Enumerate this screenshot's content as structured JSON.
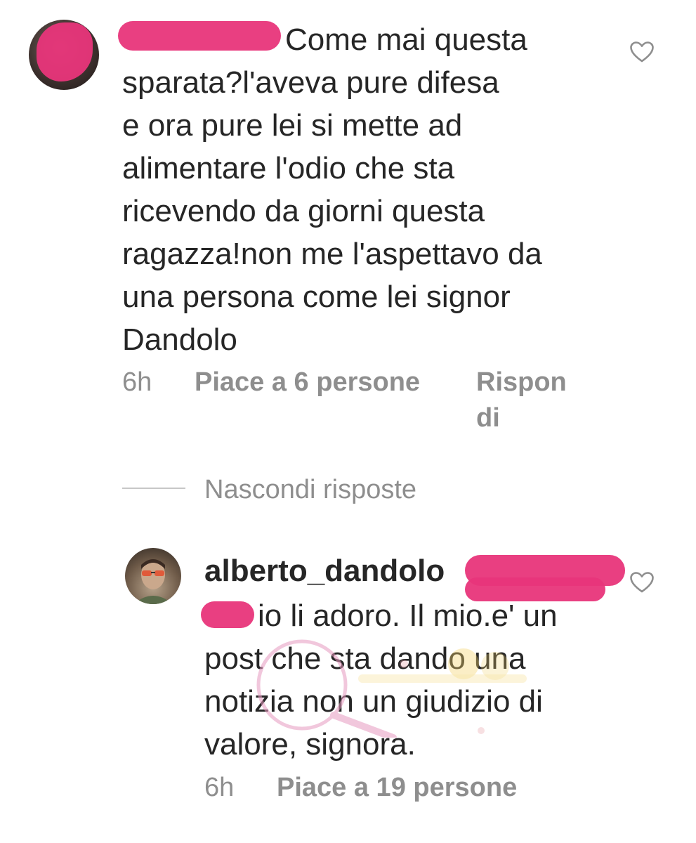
{
  "comments": [
    {
      "text_lines": [
        "Come mai questa",
        "sparata?l'aveva pure difesa",
        "e ora pure lei si mette ad",
        "alimentare l'odio che sta",
        "ricevendo da giorni questa",
        "ragazza!non me l'aspettavo da",
        "una persona come lei signor",
        "Dandolo"
      ],
      "time": "6h",
      "likes": "Piace a 6 persone",
      "reply_lines": [
        "Rispon",
        "di"
      ]
    }
  ],
  "hide_replies_label": "Nascondi risposte",
  "reply": {
    "username": "alberto_dandolo",
    "text_lines": [
      "io li adoro. Il mio.e' un",
      "post che sta dando una",
      "notizia non un giudizio di",
      "valore, signora."
    ],
    "time": "6h",
    "likes": "Piace a 19 persone"
  },
  "icons": {
    "like": "heart-outline-icon"
  },
  "colors": {
    "text": "#262626",
    "meta": "#8e8e8e",
    "redaction": "#e8357a"
  }
}
